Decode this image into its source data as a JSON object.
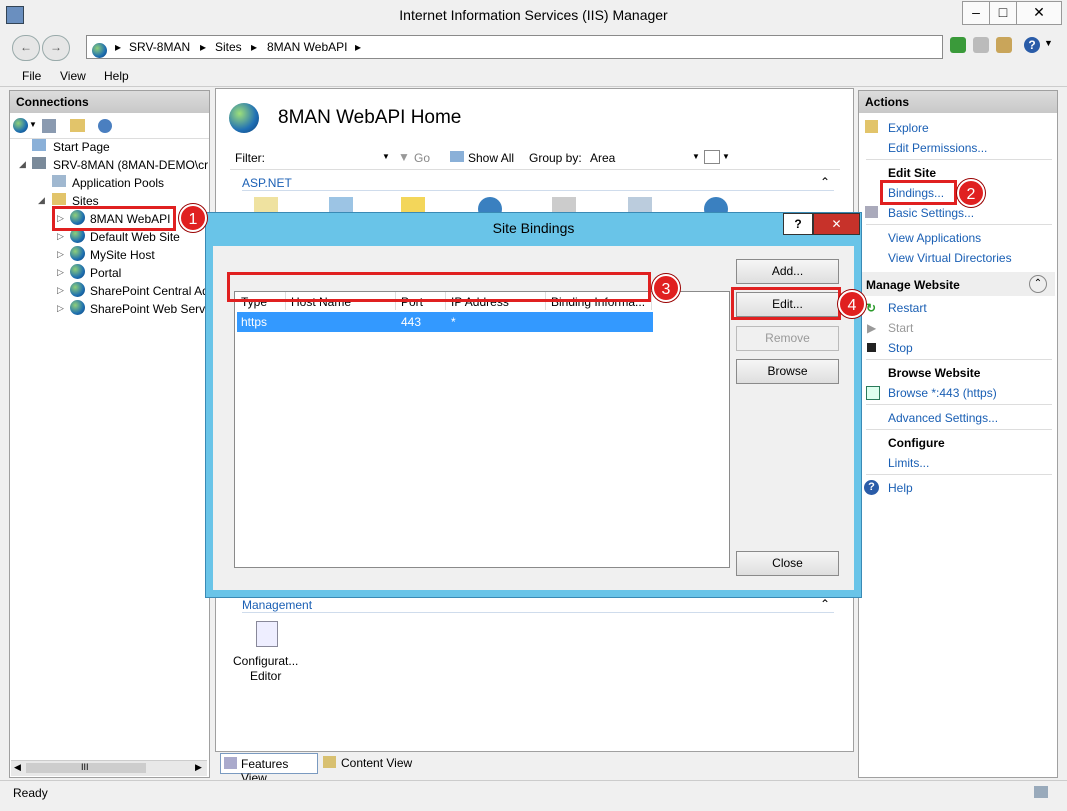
{
  "window": {
    "title": "Internet Information Services (IIS) Manager"
  },
  "address": {
    "crumbs": [
      "SRV-8MAN",
      "Sites",
      "8MAN WebAPI"
    ]
  },
  "menu": [
    "File",
    "View",
    "Help"
  ],
  "connections": {
    "title": "Connections",
    "tree": [
      "Start Page",
      "SRV-8MAN (8MAN-DEMO\\cr",
      "Application Pools",
      "Sites",
      "8MAN WebAPI",
      "Default Web Site",
      "MySite Host",
      "Portal",
      "SharePoint Central Ad",
      "SharePoint Web Servi"
    ],
    "scrollbar_label": "III"
  },
  "center": {
    "title": "8MAN WebAPI Home",
    "filter_label": "Filter:",
    "go_label": "Go",
    "show_all_label": "Show All",
    "groupby_label": "Group by:",
    "groupby_value": "Area",
    "section_aspnet": "ASP.NET",
    "section_management": "Management",
    "config_editor_line1": "Configurat...",
    "config_editor_line2": "Editor",
    "features_view": "Features View",
    "content_view": "Content View"
  },
  "actions": {
    "title": "Actions",
    "explore": "Explore",
    "edit_permissions": "Edit Permissions...",
    "edit_site": "Edit Site",
    "bindings": "Bindings...",
    "basic_settings": "Basic Settings...",
    "view_applications": "View Applications",
    "view_vdirs": "View Virtual Directories",
    "manage_website": "Manage Website",
    "restart": "Restart",
    "start": "Start",
    "stop": "Stop",
    "browse_website": "Browse Website",
    "browse_443": "Browse *:443 (https)",
    "advanced_settings": "Advanced Settings...",
    "configure": "Configure",
    "limits": "Limits...",
    "help": "Help"
  },
  "dialog": {
    "title": "Site Bindings",
    "help_btn": "?",
    "close_x": "✕",
    "columns": [
      "Type",
      "Host Name",
      "Port",
      "IP Address",
      "Binding Informa..."
    ],
    "row": {
      "type": "https",
      "host": "",
      "port": "443",
      "ip": "*",
      "info": ""
    },
    "add": "Add...",
    "edit": "Edit...",
    "remove": "Remove",
    "browse": "Browse",
    "close": "Close"
  },
  "callouts": [
    "1",
    "2",
    "3",
    "4"
  ],
  "status": {
    "text": "Ready"
  },
  "colors": {
    "dialog_frame": "#69c4e8",
    "selection": "#3399ff",
    "callout": "#e02020",
    "link": "#1a5fb4"
  }
}
